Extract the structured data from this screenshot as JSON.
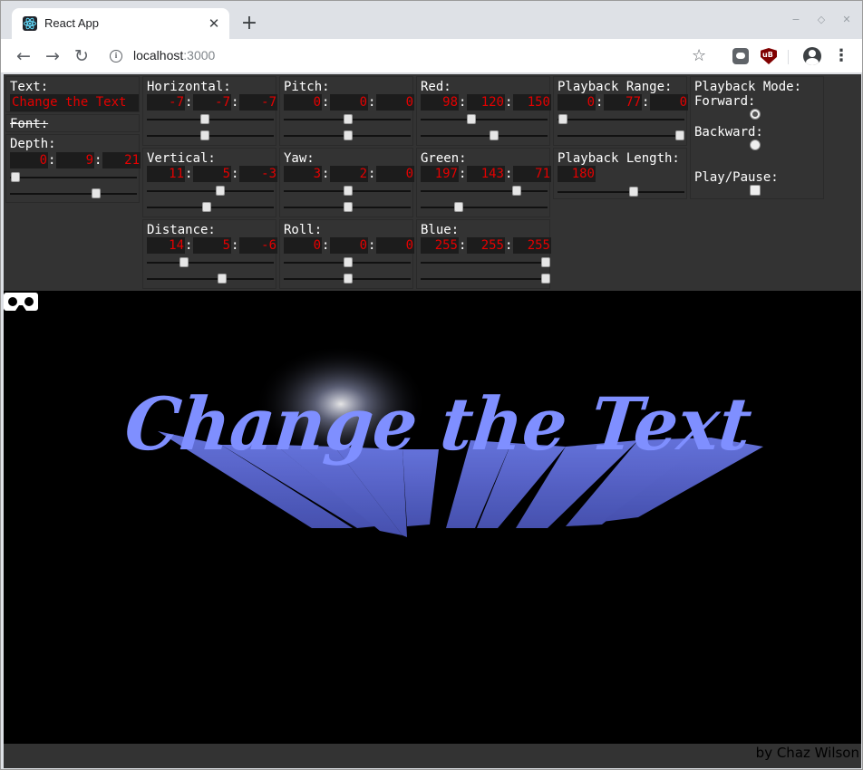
{
  "browser": {
    "tab_title": "React App",
    "tab_close_glyph": "✕",
    "new_tab_glyph": "+",
    "url_host": "localhost",
    "url_port": ":3000",
    "window_controls": [
      "minimize-icon",
      "restore-icon",
      "close-icon"
    ]
  },
  "controls": {
    "text": {
      "label": "Text:",
      "value": "Change the Text"
    },
    "font": {
      "label": "Font:"
    },
    "depth": {
      "label": "Depth:",
      "values": [
        "0",
        "9",
        "21"
      ],
      "slider_levels": [
        0.02,
        0.68
      ]
    },
    "horizontal": {
      "label": "Horizontal:",
      "values": [
        "-7",
        "-7",
        "-7"
      ],
      "slider_levels": [
        0.45,
        0.45
      ]
    },
    "vertical": {
      "label": "Vertical:",
      "values": [
        "11",
        "5",
        "-3"
      ],
      "slider_levels": [
        0.58,
        0.47
      ]
    },
    "distance": {
      "label": "Distance:",
      "values": [
        "14",
        "5",
        "-6"
      ],
      "slider_levels": [
        0.28,
        0.59
      ]
    },
    "pitch": {
      "label": "Pitch:",
      "values": [
        "0",
        "0",
        "0"
      ],
      "slider_levels": [
        0.5,
        0.5
      ]
    },
    "yaw": {
      "label": "Yaw:",
      "values": [
        "3",
        "2",
        "0"
      ],
      "slider_levels": [
        0.5,
        0.5
      ]
    },
    "roll": {
      "label": "Roll:",
      "values": [
        "0",
        "0",
        "0"
      ],
      "slider_levels": [
        0.5,
        0.5
      ]
    },
    "red": {
      "label": "Red:",
      "values": [
        "98",
        "120",
        "150"
      ],
      "slider_levels": [
        0.39,
        0.58
      ]
    },
    "green": {
      "label": "Green:",
      "values": [
        "197",
        "143",
        "71"
      ],
      "slider_levels": [
        0.76,
        0.29
      ]
    },
    "blue": {
      "label": "Blue:",
      "values": [
        "255",
        "255",
        "255"
      ],
      "slider_levels": [
        1.0,
        1.0
      ]
    },
    "playback_range": {
      "label": "Playback Range:",
      "values": [
        "0",
        "77",
        "0"
      ],
      "slider_levels": [
        0.02,
        0.98
      ]
    },
    "playback_length": {
      "label": "Playback Length:",
      "value": "180",
      "slider_level": 0.6
    },
    "playback_mode": {
      "label": "Playback Mode:",
      "forward_label": "Forward:",
      "backward_label": "Backward:",
      "selected": "forward"
    },
    "play_pause": {
      "label": "Play/Pause:",
      "checked": false
    }
  },
  "stage": {
    "rendered_text": "Change the Text",
    "text_color": "#7f8fff",
    "vr_icon": "vr-goggles-icon"
  },
  "footer": {
    "credit": "by Chaz Wilson"
  }
}
